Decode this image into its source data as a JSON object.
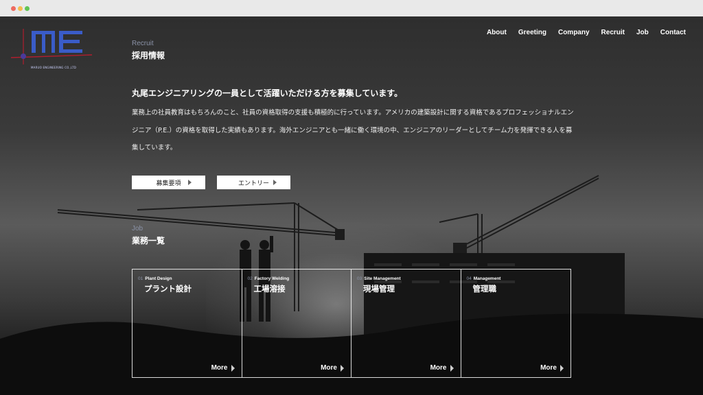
{
  "nav": {
    "items": [
      "About",
      "Greeting",
      "Company",
      "Recruit",
      "Job",
      "Contact"
    ]
  },
  "logo": {
    "letters": "ME",
    "subtitle": "MARUO ENGINEERING CO.,LTD"
  },
  "recruit": {
    "eyebrow": "Recruit",
    "heading": "採用情報",
    "lead": "丸尾エンジニアリングの一員として活躍いただける方を募集しています。",
    "body": "業務上の社員教育はもちろんのこと、社員の資格取得の支援も積極的に行っています。アメリカの建築設計に関する資格であるプロフェッショナルエンジニア（P.E.）の資格を取得した実績もあります。海外エンジニアとも一緒に働く環境の中、エンジニアのリーダーとしてチーム力を発揮できる人を募集しています。",
    "buttons": [
      "募集要項",
      "エントリー"
    ]
  },
  "job": {
    "eyebrow": "Job",
    "heading": "業務一覧",
    "cards": [
      {
        "num": "01",
        "label": "Plant Design",
        "title": "プラント設計",
        "more": "More"
      },
      {
        "num": "02",
        "label": "Factory Welding",
        "title": "工場溶接",
        "more": "More"
      },
      {
        "num": "03",
        "label": "Site Management",
        "title": "現場管理",
        "more": "More"
      },
      {
        "num": "04",
        "label": "Management",
        "title": "管理職",
        "more": "More"
      }
    ]
  }
}
